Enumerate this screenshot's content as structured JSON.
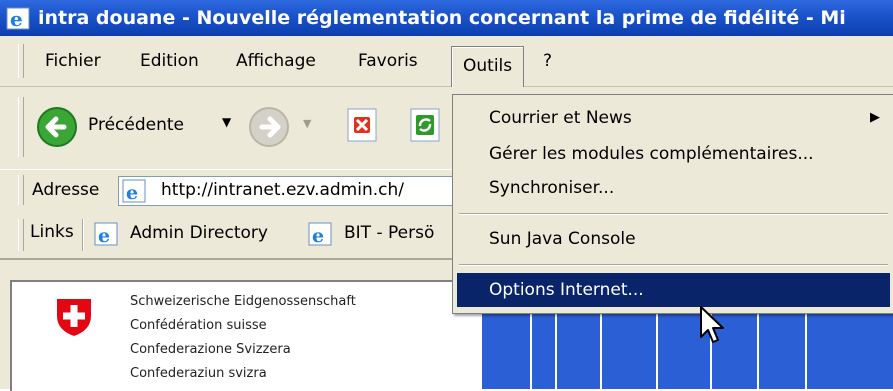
{
  "window": {
    "title": "intra douane - Nouvelle réglementation concernant la prime de fidélité - Mi"
  },
  "menubar": {
    "items": [
      "Fichier",
      "Edition",
      "Affichage",
      "Favoris",
      "Outils",
      "?"
    ]
  },
  "toolbar": {
    "back_label": "Précédente"
  },
  "addressbar": {
    "label": "Adresse",
    "url": "http://intranet.ezv.admin.ch/"
  },
  "linksbar": {
    "label": "Links",
    "links": [
      "Admin Directory",
      "BIT - Persö"
    ]
  },
  "dropdown": {
    "items": [
      {
        "label": "Courrier et News",
        "submenu": true
      },
      {
        "label": "Gérer les modules complémentaires..."
      },
      {
        "label": "Synchroniser..."
      },
      {
        "label": "Sun Java Console"
      },
      {
        "label": "Options Internet..."
      }
    ],
    "selected": "Options Internet..."
  },
  "page": {
    "federation": [
      "Schweizerische Eidgenossenschaft",
      "Confédération suisse",
      "Confederazione Svizzera",
      "Confederaziun svizra"
    ]
  },
  "colors": {
    "titlebar": "#0b3fb0",
    "selection": "#0a246a",
    "menu_bg": "#ece9d8",
    "swiss_red": "#e30613"
  }
}
